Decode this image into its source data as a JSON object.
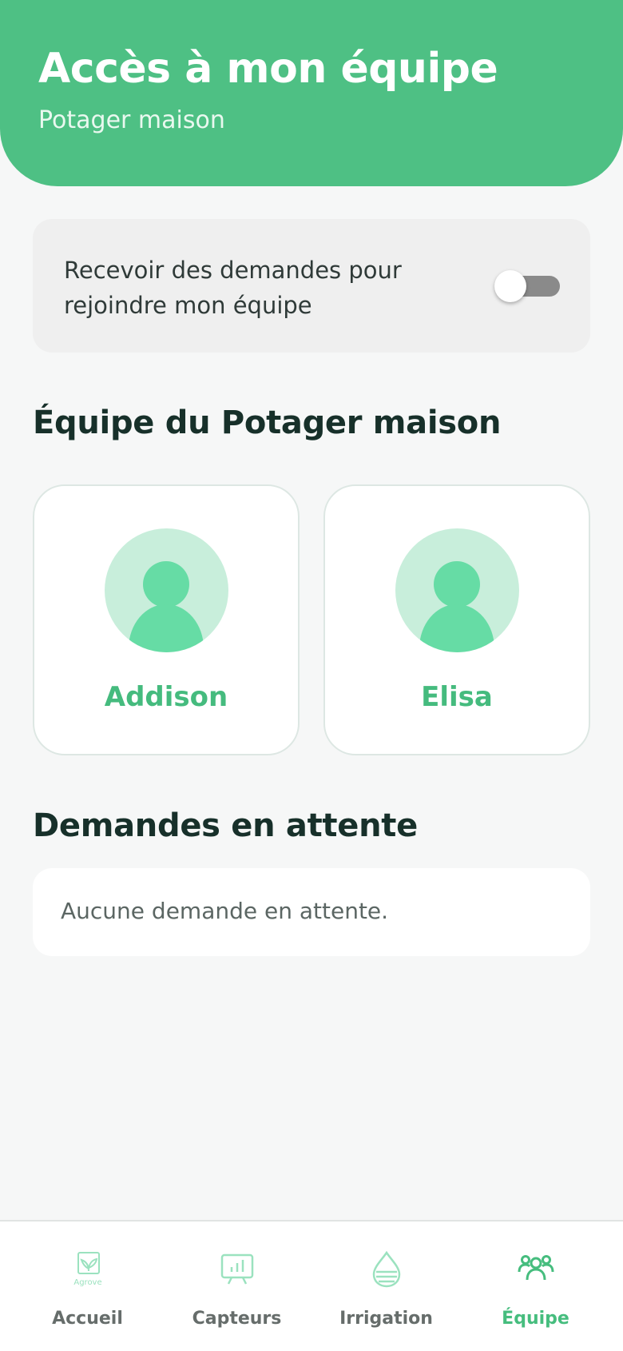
{
  "header": {
    "title": "Accès à mon équipe",
    "subtitle": "Potager maison"
  },
  "settings": {
    "join_requests_label": "Recevoir des demandes pour rejoindre mon équipe",
    "join_requests_enabled": false
  },
  "team": {
    "title": "Équipe du Potager maison",
    "members": [
      {
        "name": "Addison"
      },
      {
        "name": "Elisa"
      }
    ]
  },
  "pending": {
    "title": "Demandes en attente",
    "empty_message": "Aucune demande en attente."
  },
  "bottom_nav": {
    "items": [
      {
        "label": "Accueil",
        "icon": "agrove-logo-icon",
        "icon_text": "Agrove",
        "active": false
      },
      {
        "label": "Capteurs",
        "icon": "sensor-chart-icon",
        "active": false
      },
      {
        "label": "Irrigation",
        "icon": "water-drop-icon",
        "active": false
      },
      {
        "label": "Équipe",
        "icon": "team-users-icon",
        "active": true
      }
    ]
  },
  "colors": {
    "brand": "#4ec084",
    "accent_text": "#45bb7e",
    "avatar_bg": "#c8eedb",
    "avatar_fg": "#66dca5",
    "inactive_icon": "#9be2bf"
  }
}
